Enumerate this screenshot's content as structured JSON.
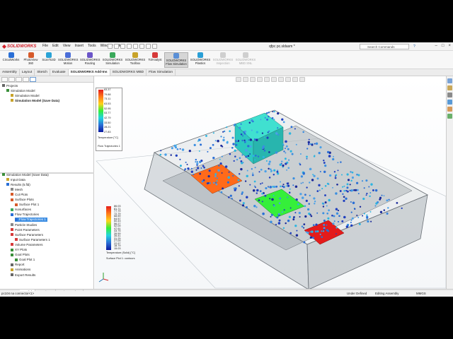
{
  "app": {
    "brand": "SOLIDWORKS",
    "doc_title": "qfpc pc.sldasm *"
  },
  "menu": [
    "File",
    "Edit",
    "View",
    "Insert",
    "Tools",
    "Window",
    "Help"
  ],
  "search_placeholder": "Search Commands",
  "ribbon": [
    {
      "label": "CircuitWorks",
      "label2": "",
      "color": "#2a6fd6"
    },
    {
      "label": "PhotoView",
      "label2": "360",
      "color": "#d65a2a"
    },
    {
      "label": "ScanTo3D",
      "label2": "",
      "color": "#2aa3d6"
    },
    {
      "label": "SOLIDWORKS",
      "label2": "Motion",
      "color": "#4b6ed8"
    },
    {
      "label": "SOLIDWORKS",
      "label2": "Routing",
      "color": "#6b55c8"
    },
    {
      "label": "SOLIDWORKS",
      "label2": "Simulation",
      "color": "#3aa85a"
    },
    {
      "label": "SOLIDWORKS",
      "label2": "Toolbox",
      "color": "#c8a32a"
    },
    {
      "label": "TolAnalyst",
      "label2": "",
      "color": "#d63a3a"
    },
    {
      "label": "SOLIDWORKS",
      "label2": "Flow Simulation",
      "color": "#5a8fd6"
    },
    {
      "label": "SOLIDWORKS",
      "label2": "Plastics",
      "color": "#2a9fd6"
    },
    {
      "label": "SOLIDWORKS",
      "label2": "Inspection",
      "color": "#cfcfcf"
    },
    {
      "label": "SOLIDWORKS",
      "label2": "MBD SNL",
      "color": "#cfcfcf"
    }
  ],
  "cm_tabs": [
    "Assembly",
    "Layout",
    "Sketch",
    "Evaluate",
    "SOLIDWORKS Add-Ins",
    "SOLIDWORKS MBD",
    "Flow Simulation"
  ],
  "cm_tab_active": 4,
  "tree_top": [
    {
      "label": "Projects",
      "indent": 0,
      "bold": false,
      "color": "#666"
    },
    {
      "label": "Simulation Model",
      "indent": 1,
      "bold": false,
      "color": "#3a8f3a"
    },
    {
      "label": "Simulation Model",
      "indent": 2,
      "bold": false,
      "color": "#c8a32a"
    },
    {
      "label": "Simulation Model (Save Data)",
      "indent": 2,
      "bold": true,
      "color": "#c8a32a"
    }
  ],
  "tree_bottom": [
    {
      "label": "Simulation Model (Save Data)",
      "indent": 0,
      "sel": false,
      "color": "#3a8f3a"
    },
    {
      "label": "Input Data",
      "indent": 1,
      "sel": false,
      "color": "#c8a32a"
    },
    {
      "label": "Results (5.fld)",
      "indent": 1,
      "sel": false,
      "color": "#2a6fd6"
    },
    {
      "label": "Mesh",
      "indent": 2,
      "sel": false,
      "color": "#888"
    },
    {
      "label": "Cut Plots",
      "indent": 2,
      "sel": false,
      "color": "#d65a2a"
    },
    {
      "label": "Surface Plots",
      "indent": 2,
      "sel": false,
      "color": "#d65a2a"
    },
    {
      "label": "Surface Plot 1",
      "indent": 3,
      "sel": false,
      "color": "#d65a2a"
    },
    {
      "label": "Isosurfaces",
      "indent": 2,
      "sel": false,
      "color": "#3aa85a"
    },
    {
      "label": "Flow Trajectories",
      "indent": 2,
      "sel": false,
      "color": "#2a6fd6"
    },
    {
      "label": "Flow Trajectories 1",
      "indent": 3,
      "sel": true,
      "color": "#2a6fd6"
    },
    {
      "label": "Particle Studies",
      "indent": 2,
      "sel": false,
      "color": "#888"
    },
    {
      "label": "Point Parameters",
      "indent": 2,
      "sel": false,
      "color": "#d63a3a"
    },
    {
      "label": "Surface Parameters",
      "indent": 2,
      "sel": false,
      "color": "#d63a3a"
    },
    {
      "label": "Surface Parameters 1",
      "indent": 3,
      "sel": false,
      "color": "#d63a3a"
    },
    {
      "label": "Volume Parameters",
      "indent": 2,
      "sel": false,
      "color": "#d63a3a"
    },
    {
      "label": "XY Plots",
      "indent": 2,
      "sel": false,
      "color": "#3a8f3a"
    },
    {
      "label": "Goal Plots",
      "indent": 2,
      "sel": false,
      "color": "#3a8f3a"
    },
    {
      "label": "Goal Plot 1",
      "indent": 3,
      "sel": false,
      "color": "#3a8f3a"
    },
    {
      "label": "Report",
      "indent": 2,
      "sel": false,
      "color": "#666"
    },
    {
      "label": "Animations",
      "indent": 2,
      "sel": false,
      "color": "#c8a32a"
    },
    {
      "label": "Export Results",
      "indent": 2,
      "sel": false,
      "color": "#666"
    }
  ],
  "legend_traj": {
    "ticks": [
      "83.37",
      "79.88",
      "73.11",
      "63.53",
      "52.95",
      "53.77",
      "42.79",
      "33.50",
      "28.21",
      "27.83"
    ],
    "title": "Temperature [°C]",
    "caption": "Flow Trajectories 1"
  },
  "legend_surf": {
    "ticks": [
      "86.03",
      "81.71",
      "77.79",
      "72.79",
      "68.59",
      "64.57",
      "60.43",
      "56.27",
      "52.09",
      "47.91",
      "43.75",
      "39.59",
      "35.41",
      "31.25",
      "27.09",
      "22.97",
      "18.79",
      "15.03"
    ],
    "title": "Temperature (Solid) [°C]",
    "caption": "Surface Plot 1: contours"
  },
  "bottom_tabs": [
    "Model",
    "3D Views",
    "Motion Study 1"
  ],
  "bottom_tab_active": 0,
  "status": {
    "left": "pc104 na connector<1>",
    "mid1": "Under Defined",
    "mid2": "Editing Assembly",
    "units": "MMGS"
  }
}
